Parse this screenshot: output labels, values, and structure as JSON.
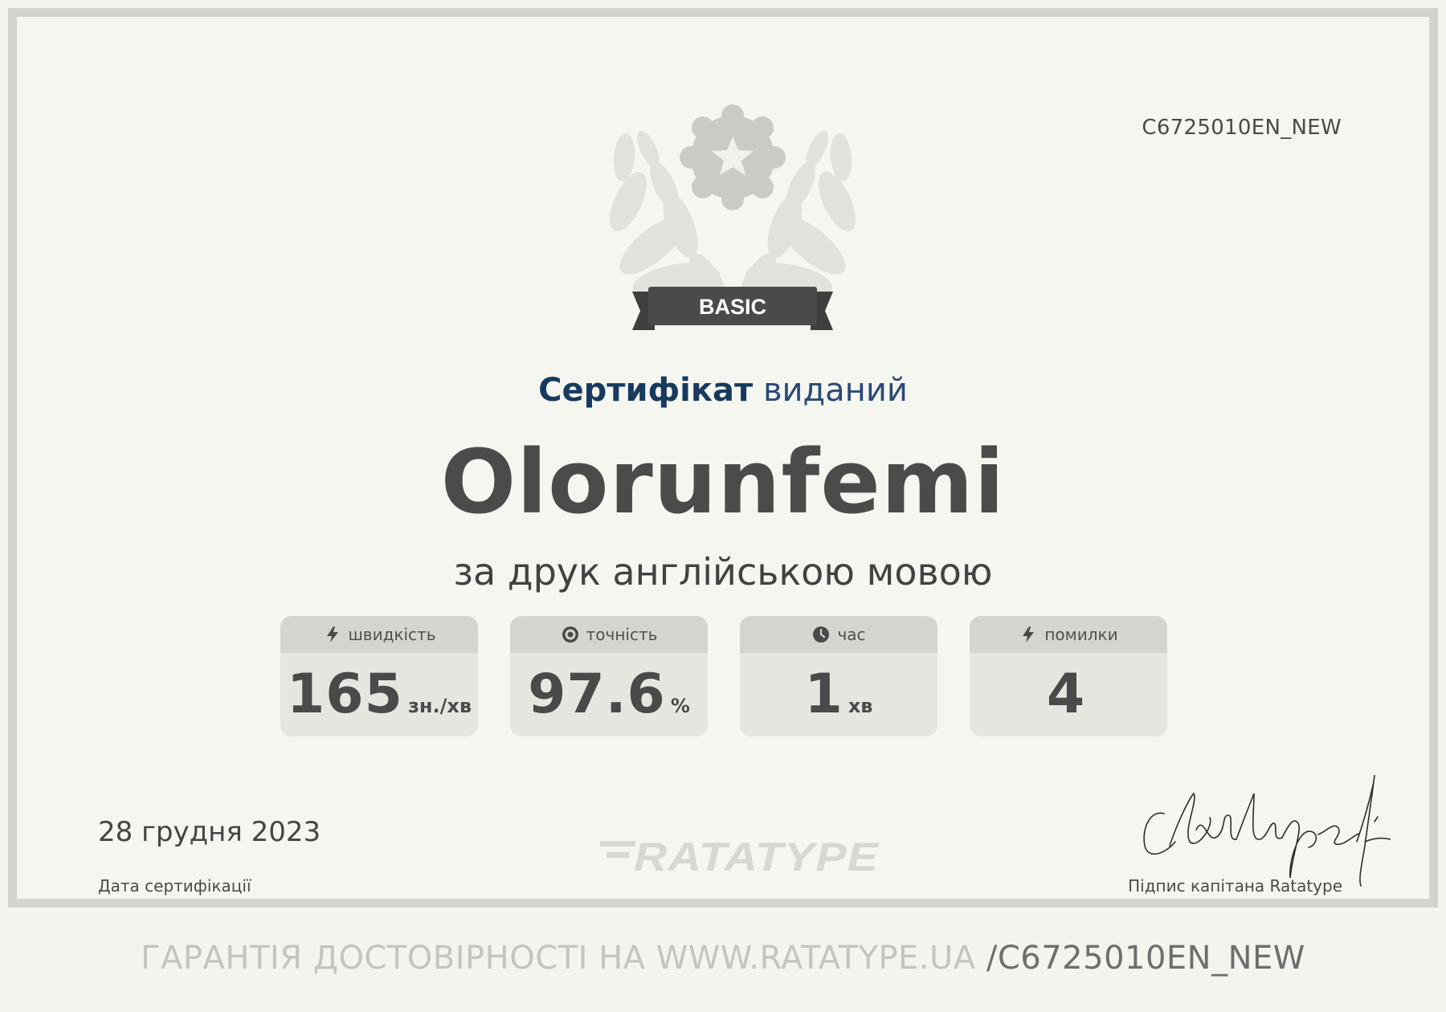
{
  "certificate": {
    "code": "C6725010EN_NEW",
    "level_badge": "BASIC",
    "issued_strong": "Сертифікат",
    "issued_light": "виданий",
    "recipient": "Olorunfemi",
    "subtitle": "за друк англійською мовою",
    "date": "28 грудня 2023",
    "date_label": "Дата сертифікації",
    "signature_label": "Підпис капітана Ratatype",
    "logo": "RATATYPE",
    "verification_prefix": "ГАРАНТІЯ ДОСТОВІРНОСТІ НА WWW.RATATYPE.UA ",
    "verification_code": "/C6725010EN_NEW"
  },
  "stats": [
    {
      "label": "швидкість",
      "value": "165",
      "unit": "зн./хв",
      "icon": "lightning-icon"
    },
    {
      "label": "точність",
      "value": "97.6",
      "unit": "%",
      "icon": "target-icon"
    },
    {
      "label": "час",
      "value": "1",
      "unit": "хв",
      "icon": "clock-icon"
    },
    {
      "label": "помилки",
      "value": "4",
      "unit": "",
      "icon": "lightning-icon"
    }
  ],
  "colors": {
    "background": "#f5f6f0",
    "border": "#d4d4cc",
    "title_blue": "#173a5e",
    "text_dark": "#4b4b4b"
  }
}
